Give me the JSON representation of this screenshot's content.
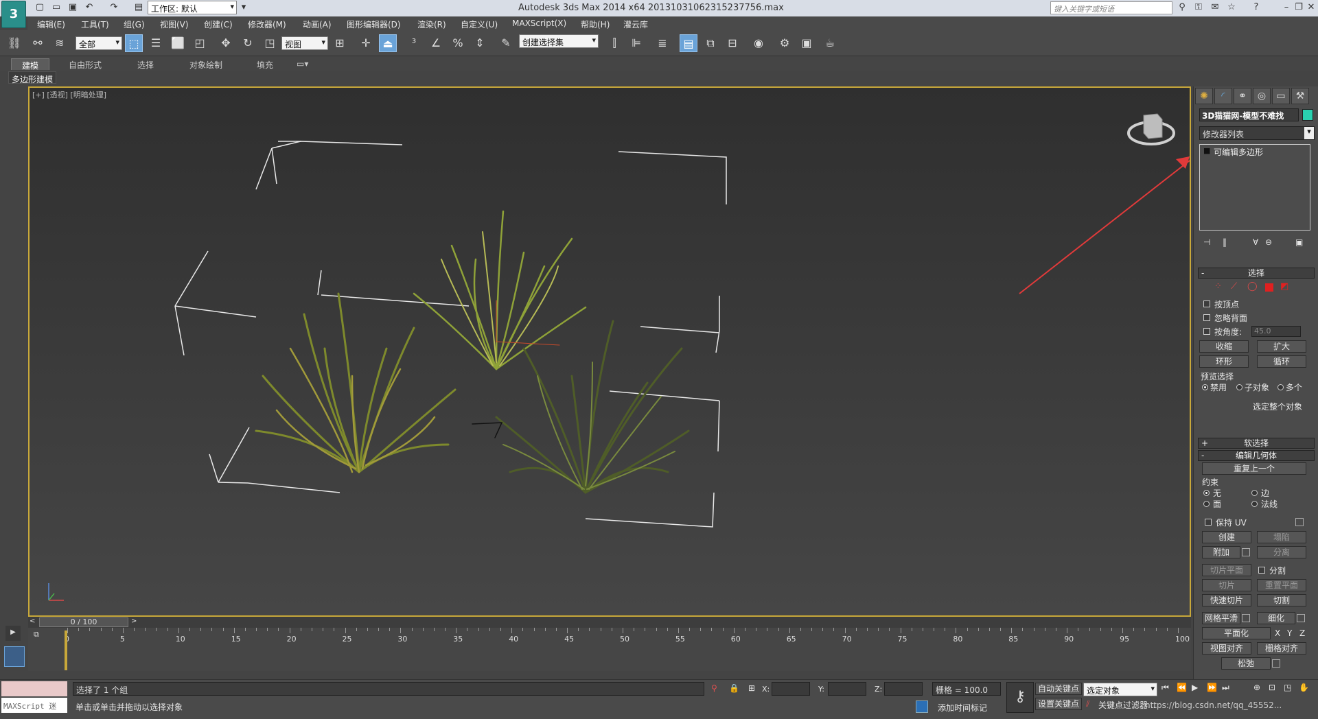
{
  "window": {
    "title": "Autodesk 3ds Max  2014 x64      20131031062315237756.max",
    "workspace": "工作区: 默认",
    "search_placeholder": "键入关键字或短语"
  },
  "menu": [
    "编辑(E)",
    "工具(T)",
    "组(G)",
    "视图(V)",
    "创建(C)",
    "修改器(M)",
    "动画(A)",
    "图形编辑器(D)",
    "渲染(R)",
    "自定义(U)",
    "MAXScript(X)",
    "帮助(H)",
    "灌云库"
  ],
  "toolbar": {
    "selection_filter": "全部",
    "ref_coord": "视图",
    "named_selection": "创建选择集"
  },
  "ribbon": {
    "tabs": [
      "建模",
      "自由形式",
      "选择",
      "对象绘制",
      "填充"
    ],
    "active_tab": "建模",
    "sub_tab": "多边形建模"
  },
  "viewport": {
    "label_plus": "[+]",
    "label_view": "[透视]",
    "label_shading": "[明暗处理]"
  },
  "command_panel": {
    "object_name": "3D猫猫网-模型不难找",
    "object_color": "#2ad1b0",
    "modifier_list": "修改器列表",
    "stack_item": "可编辑多边形",
    "selection": {
      "title": "选择",
      "by_vertex": "按顶点",
      "ignore_backfacing": "忽略背面",
      "by_angle": "按角度:",
      "angle_value": "45.0",
      "shrink": "收缩",
      "grow": "扩大",
      "ring": "环形",
      "loop": "循环",
      "preview_title": "预览选择",
      "preview_options": [
        "禁用",
        "子对象",
        "多个"
      ],
      "whole_object": "选定整个对象"
    },
    "soft_selection": "软选择",
    "edit_geometry": {
      "title": "编辑几何体",
      "repeat_last": "重复上一个",
      "constraints": "约束",
      "constraint_options": [
        "无",
        "边",
        "面",
        "法线"
      ],
      "preserve_uv": "保持 UV",
      "create": "创建",
      "collapse": "塌陷",
      "attach": "附加",
      "detach": "分离",
      "slice_plane": "切片平面",
      "split": "分割",
      "slice": "切片",
      "reset_plane": "重置平面",
      "quickslice": "快速切片",
      "cut": "切割",
      "meshsmooth": "网格平滑",
      "tessellate": "细化",
      "make_planar": "平面化",
      "x": "X",
      "y": "Y",
      "z": "Z",
      "view_align": "视图对齐",
      "grid_align": "栅格对齐",
      "relax": "松弛"
    }
  },
  "timeline": {
    "frame_display": "0 / 100",
    "ticks": [
      "0",
      "5",
      "10",
      "15",
      "20",
      "25",
      "30",
      "35",
      "40",
      "45",
      "50",
      "55",
      "60",
      "65",
      "70",
      "75",
      "80",
      "85",
      "90",
      "95",
      "100"
    ]
  },
  "status": {
    "maxscript_label": "MAXScript 迷",
    "selection_info": "选择了 1 个组",
    "prompt": "单击或单击并拖动以选择对象",
    "x_label": "X:",
    "y_label": "Y:",
    "z_label": "Z:",
    "grid": "栅格 = 100.0",
    "auto_key": "自动关键点",
    "set_key": "设置关键点",
    "selected_object": "选定对象",
    "add_time_tag": "添加时间标记",
    "key_filter": "关键点过滤器...",
    "watermark": "https://blog.csdn.net/qq_45552..."
  }
}
